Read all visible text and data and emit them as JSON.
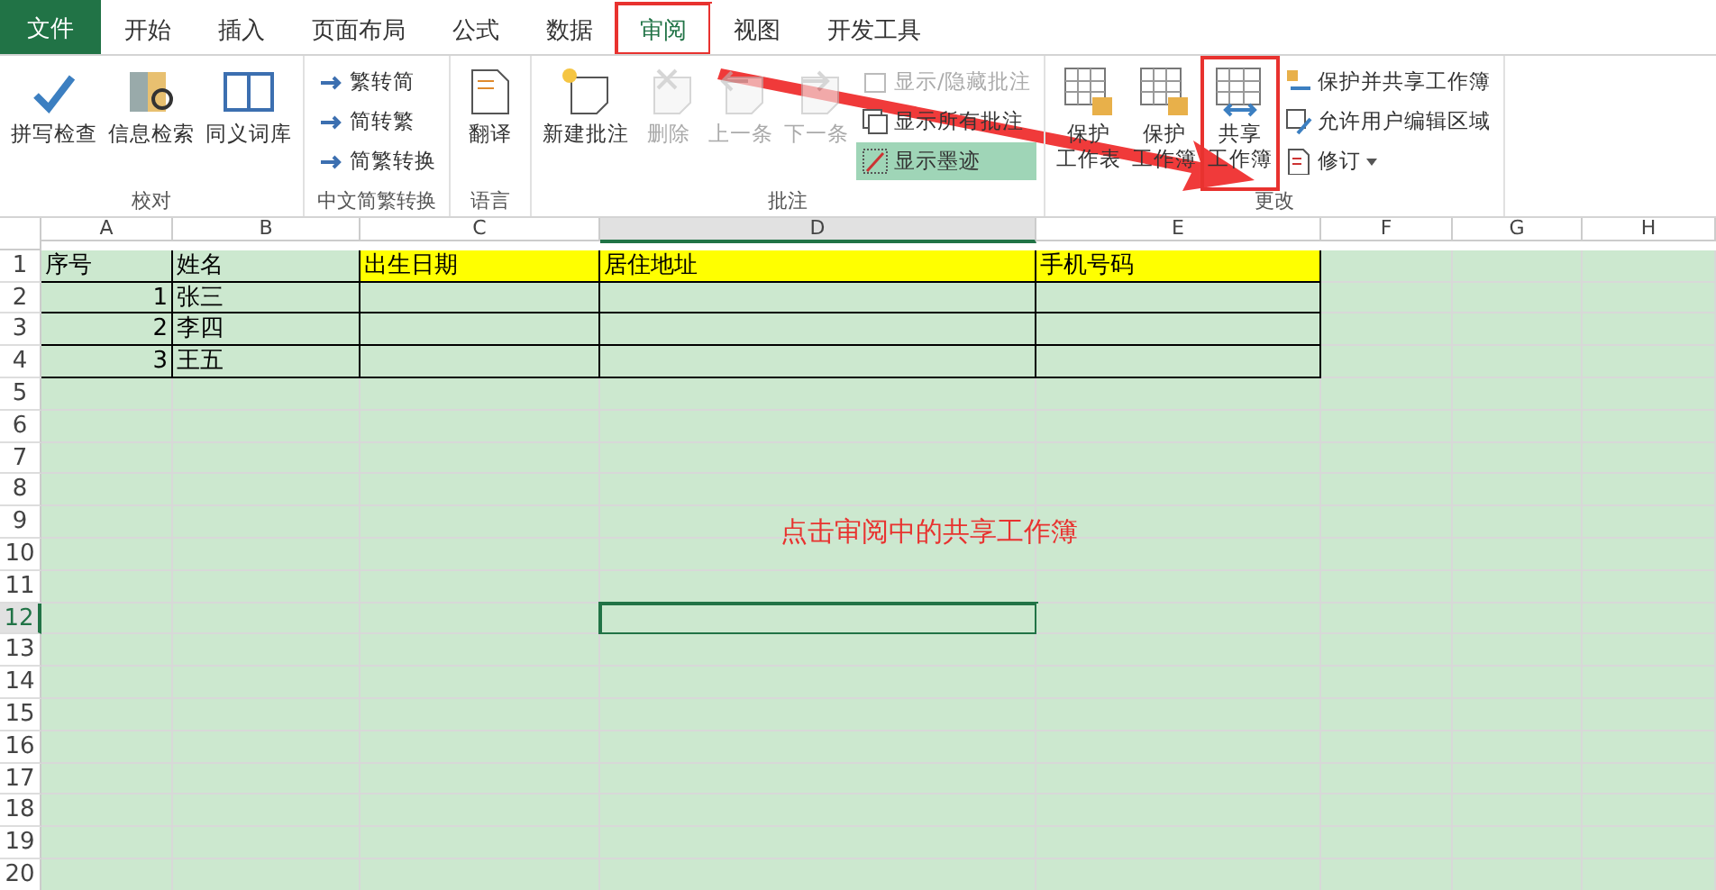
{
  "tabs": [
    {
      "label": "文件",
      "kind": "file",
      "selected": false,
      "callout": false
    },
    {
      "label": "开始",
      "kind": "tab",
      "selected": false,
      "callout": false
    },
    {
      "label": "插入",
      "kind": "tab",
      "selected": false,
      "callout": false
    },
    {
      "label": "页面布局",
      "kind": "tab",
      "selected": false,
      "callout": false
    },
    {
      "label": "公式",
      "kind": "tab",
      "selected": false,
      "callout": false
    },
    {
      "label": "数据",
      "kind": "tab",
      "selected": false,
      "callout": false
    },
    {
      "label": "审阅",
      "kind": "tab",
      "selected": true,
      "callout": true
    },
    {
      "label": "视图",
      "kind": "tab",
      "selected": false,
      "callout": false
    },
    {
      "label": "开发工具",
      "kind": "tab",
      "selected": false,
      "callout": false
    }
  ],
  "ribbon": [
    {
      "label": "校对",
      "items": [
        {
          "kind": "large",
          "label": "拼写检查",
          "disabled": false,
          "callout": false
        },
        {
          "kind": "large",
          "label": "信息检索",
          "disabled": false,
          "callout": false
        },
        {
          "kind": "large",
          "label": "同义词库",
          "disabled": false,
          "callout": false
        }
      ]
    },
    {
      "label": "中文简繁转换",
      "items": [
        {
          "kind": "small",
          "label": "繁转简",
          "disabled": false,
          "active": false
        },
        {
          "kind": "small",
          "label": "简转繁",
          "disabled": false,
          "active": false
        },
        {
          "kind": "small",
          "label": "简繁转换",
          "disabled": false,
          "active": false
        }
      ]
    },
    {
      "label": "语言",
      "items": [
        {
          "kind": "large",
          "label": "翻译",
          "disabled": false,
          "callout": false
        }
      ]
    },
    {
      "label": "批注",
      "items": [
        {
          "kind": "large",
          "label": "新建批注",
          "disabled": false,
          "callout": false
        },
        {
          "kind": "large",
          "label": "删除",
          "disabled": true,
          "callout": false
        },
        {
          "kind": "large",
          "label": "上一条",
          "disabled": true,
          "callout": false
        },
        {
          "kind": "large",
          "label": "下一条",
          "disabled": true,
          "callout": false
        },
        {
          "kind": "small",
          "label": "显示/隐藏批注",
          "disabled": true,
          "active": false
        },
        {
          "kind": "small",
          "label": "显示所有批注",
          "disabled": false,
          "active": false
        },
        {
          "kind": "small",
          "label": "显示墨迹",
          "disabled": false,
          "active": true
        }
      ]
    },
    {
      "label": "更改",
      "items": [
        {
          "kind": "large",
          "label_lines": [
            "保护",
            "工作表"
          ],
          "disabled": false,
          "callout": false
        },
        {
          "kind": "large",
          "label_lines": [
            "保护",
            "工作簿"
          ],
          "disabled": false,
          "callout": false
        },
        {
          "kind": "large",
          "label_lines": [
            "共享",
            "工作簿"
          ],
          "disabled": false,
          "callout": true
        },
        {
          "kind": "small",
          "label": "保护并共享工作簿",
          "disabled": false,
          "active": false
        },
        {
          "kind": "small",
          "label": "允许用户编辑区域",
          "disabled": false,
          "active": false
        },
        {
          "kind": "small",
          "label": "修订",
          "disabled": false,
          "active": false,
          "dropdown": true
        }
      ]
    }
  ],
  "sheet": {
    "columns": [
      {
        "label": "A",
        "selected": false
      },
      {
        "label": "B",
        "selected": false
      },
      {
        "label": "C",
        "selected": false
      },
      {
        "label": "D",
        "selected": true
      },
      {
        "label": "E",
        "selected": false
      },
      {
        "label": "F",
        "selected": false
      },
      {
        "label": "G",
        "selected": false
      },
      {
        "label": "H",
        "selected": false
      }
    ],
    "rows": [
      {
        "label": "1",
        "selected": false,
        "cells": [
          {
            "text": "序号",
            "kind": "text",
            "highlighted": false
          },
          {
            "text": "姓名",
            "kind": "text",
            "highlighted": false
          },
          {
            "text": "出生日期",
            "kind": "text",
            "highlighted": true
          },
          {
            "text": "居住地址",
            "kind": "text",
            "highlighted": true
          },
          {
            "text": "手机号码",
            "kind": "text",
            "highlighted": true
          }
        ]
      },
      {
        "label": "2",
        "selected": false,
        "cells": [
          {
            "text": "1",
            "kind": "number",
            "highlighted": false
          },
          {
            "text": "张三",
            "kind": "text",
            "highlighted": false
          },
          {
            "kind": "empty",
            "highlighted": false
          },
          {
            "kind": "empty",
            "highlighted": false
          },
          {
            "kind": "empty",
            "highlighted": false
          }
        ]
      },
      {
        "label": "3",
        "selected": false,
        "cells": [
          {
            "text": "2",
            "kind": "number",
            "highlighted": false
          },
          {
            "text": "李四",
            "kind": "text",
            "highlighted": false
          },
          {
            "kind": "empty",
            "highlighted": false
          },
          {
            "kind": "empty",
            "highlighted": false
          },
          {
            "kind": "empty",
            "highlighted": false
          }
        ]
      },
      {
        "label": "4",
        "selected": false,
        "cells": [
          {
            "text": "3",
            "kind": "number",
            "highlighted": false
          },
          {
            "text": "王五",
            "kind": "text",
            "highlighted": false
          },
          {
            "kind": "empty",
            "highlighted": false
          },
          {
            "kind": "empty",
            "highlighted": false
          },
          {
            "kind": "empty",
            "highlighted": false
          }
        ]
      },
      {
        "label": "5",
        "selected": false
      },
      {
        "label": "6",
        "selected": false
      },
      {
        "label": "7",
        "selected": false
      },
      {
        "label": "8",
        "selected": false
      },
      {
        "label": "9",
        "selected": false
      },
      {
        "label": "10",
        "selected": false
      },
      {
        "label": "11",
        "selected": false
      },
      {
        "label": "12",
        "selected": true,
        "cells": [
          {
            "kind": "blank",
            "current": false
          },
          {
            "kind": "blank",
            "current": false
          },
          {
            "kind": "blank",
            "current": false
          },
          {
            "kind": "blank",
            "current": true
          }
        ]
      },
      {
        "label": "13",
        "selected": false
      },
      {
        "label": "14",
        "selected": false
      },
      {
        "label": "15",
        "selected": false
      },
      {
        "label": "16",
        "selected": false
      },
      {
        "label": "17",
        "selected": false
      },
      {
        "label": "18",
        "selected": false
      },
      {
        "label": "19",
        "selected": false
      },
      {
        "label": "20",
        "selected": false
      }
    ]
  },
  "annotation": {
    "caption": "点击审阅中的共享工作簿"
  }
}
